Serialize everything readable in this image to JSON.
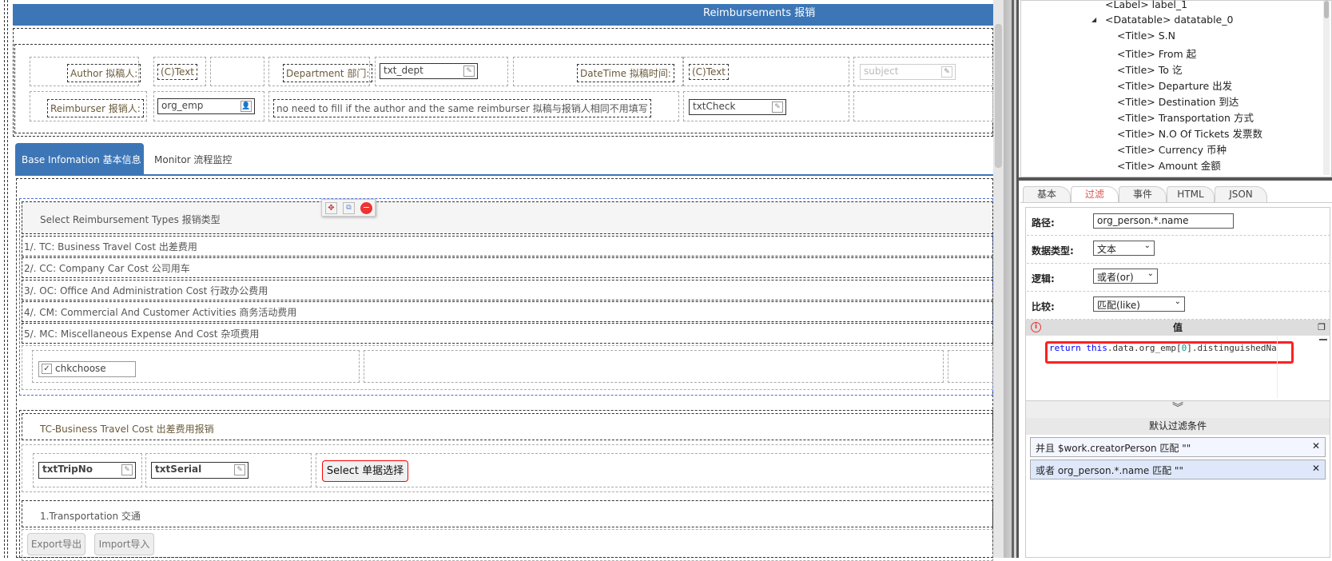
{
  "form": {
    "title": "Reimbursements 报销",
    "author_label": "Author 拟稿人:",
    "author_value": "(C)Text",
    "dept_label": "Department 部门:",
    "dept_value": "txt_dept",
    "datetime_label": "DateTime 拟稿时间:",
    "datetime_value": "(C)Text",
    "subject_value": "subject",
    "reimburser_label": "Reimburser 报销人:",
    "reimburser_value": "org_emp",
    "note": "no need to fill if the author and the same reimburser 拟稿与报销人相同不用填写",
    "check_value": "txtCheck",
    "tabs": [
      {
        "label": "Base Infomation 基本信息"
      },
      {
        "label": "Monitor 流程监控"
      }
    ],
    "types_header": "Select Reimbursement Types 报销类型",
    "types": [
      "1/. TC: Business Travel Cost 出差费用",
      "2/. CC: Company Car Cost 公司用车",
      "3/. OC: Office And Administration Cost 行政办公费用",
      "4/. CM: Commercial And Customer Activities 商务活动费用",
      "5/. MC: Miscellaneous Expense And Cost 杂项费用"
    ],
    "chk_value": "chkchoose",
    "tc_header": "TC-Business Travel Cost 出差费用报销",
    "trip_no": "txtTripNo",
    "serial": "txtSerial",
    "select_button": "Select 单据选择",
    "transport_header": "1.Transportation 交通",
    "export_button": "Export导出",
    "import_button": "Import导入"
  },
  "tree": {
    "items": [
      "<Label> label_1",
      "<Datatable> datatable_0",
      "<Title> S.N",
      "<Title> From 起",
      "<Title> To 讫",
      "<Title> Departure 出发",
      "<Title> Destination 到达",
      "<Title> Transportation 方式",
      "<Title> N.O Of Tickets 发票数",
      "<Title> Currency 币种",
      "<Title> Amount 金额"
    ]
  },
  "props": {
    "tabs": [
      "基本",
      "过滤",
      "事件",
      "HTML",
      "JSON"
    ],
    "path_label": "路径:",
    "path_value": "org_person.*.name",
    "type_label": "数据类型:",
    "type_value": "文本",
    "logic_label": "逻辑:",
    "logic_value": "或者(or)",
    "compare_label": "比较:",
    "compare_value": "匹配(like)",
    "value_header": "值",
    "code_kw1": "return",
    "code_kw2": "this",
    "code_rest": ".data.org_emp[",
    "code_num": "0",
    "code_end": "].distinguishedNar",
    "default_header": "默认过滤条件",
    "conditions": [
      "并且 $work.creatorPerson 匹配 \"\"",
      "或者 org_person.*.name 匹配 \"\""
    ]
  },
  "colors": {
    "accent": "#3c76b7",
    "active_tab_text": "#d9534f",
    "highlight": "#ff2020"
  }
}
